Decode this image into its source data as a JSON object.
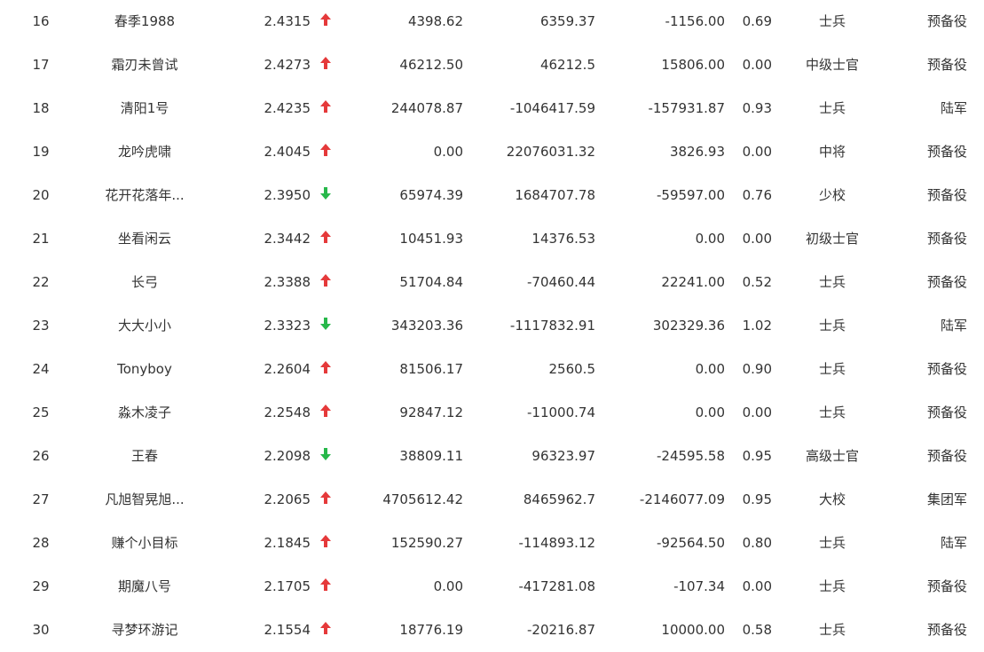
{
  "colors": {
    "up": "#e5393a",
    "down": "#27b84a",
    "text": "#333333"
  },
  "rows": [
    {
      "rank": "16",
      "name": "春季1988",
      "score": "2.4315",
      "trend": "up",
      "v1": "4398.62",
      "v2": "6359.37",
      "v3": "-1156.00",
      "ratio": "0.69",
      "rank_title": "士兵",
      "unit": "预备役"
    },
    {
      "rank": "17",
      "name": "霜刃未曾试",
      "score": "2.4273",
      "trend": "up",
      "v1": "46212.50",
      "v2": "46212.5",
      "v3": "15806.00",
      "ratio": "0.00",
      "rank_title": "中级士官",
      "unit": "预备役"
    },
    {
      "rank": "18",
      "name": "清阳1号",
      "score": "2.4235",
      "trend": "up",
      "v1": "244078.87",
      "v2": "-1046417.59",
      "v3": "-157931.87",
      "ratio": "0.93",
      "rank_title": "士兵",
      "unit": "陆军"
    },
    {
      "rank": "19",
      "name": "龙吟虎啸",
      "score": "2.4045",
      "trend": "up",
      "v1": "0.00",
      "v2": "22076031.32",
      "v3": "3826.93",
      "ratio": "0.00",
      "rank_title": "中将",
      "unit": "预备役"
    },
    {
      "rank": "20",
      "name": "花开花落年...",
      "score": "2.3950",
      "trend": "down",
      "v1": "65974.39",
      "v2": "1684707.78",
      "v3": "-59597.00",
      "ratio": "0.76",
      "rank_title": "少校",
      "unit": "预备役"
    },
    {
      "rank": "21",
      "name": "坐看闲云",
      "score": "2.3442",
      "trend": "up",
      "v1": "10451.93",
      "v2": "14376.53",
      "v3": "0.00",
      "ratio": "0.00",
      "rank_title": "初级士官",
      "unit": "预备役"
    },
    {
      "rank": "22",
      "name": "长弓",
      "score": "2.3388",
      "trend": "up",
      "v1": "51704.84",
      "v2": "-70460.44",
      "v3": "22241.00",
      "ratio": "0.52",
      "rank_title": "士兵",
      "unit": "预备役"
    },
    {
      "rank": "23",
      "name": "大大小小",
      "score": "2.3323",
      "trend": "down",
      "v1": "343203.36",
      "v2": "-1117832.91",
      "v3": "302329.36",
      "ratio": "1.02",
      "rank_title": "士兵",
      "unit": "陆军"
    },
    {
      "rank": "24",
      "name": "Tonyboy",
      "score": "2.2604",
      "trend": "up",
      "v1": "81506.17",
      "v2": "2560.5",
      "v3": "0.00",
      "ratio": "0.90",
      "rank_title": "士兵",
      "unit": "预备役"
    },
    {
      "rank": "25",
      "name": "淼木凌子",
      "score": "2.2548",
      "trend": "up",
      "v1": "92847.12",
      "v2": "-11000.74",
      "v3": "0.00",
      "ratio": "0.00",
      "rank_title": "士兵",
      "unit": "预备役"
    },
    {
      "rank": "26",
      "name": "王春",
      "score": "2.2098",
      "trend": "down",
      "v1": "38809.11",
      "v2": "96323.97",
      "v3": "-24595.58",
      "ratio": "0.95",
      "rank_title": "高级士官",
      "unit": "预备役"
    },
    {
      "rank": "27",
      "name": "凡旭智晃旭...",
      "score": "2.2065",
      "trend": "up",
      "v1": "4705612.42",
      "v2": "8465962.7",
      "v3": "-2146077.09",
      "ratio": "0.95",
      "rank_title": "大校",
      "unit": "集团军"
    },
    {
      "rank": "28",
      "name": "赚个小目标",
      "score": "2.1845",
      "trend": "up",
      "v1": "152590.27",
      "v2": "-114893.12",
      "v3": "-92564.50",
      "ratio": "0.80",
      "rank_title": "士兵",
      "unit": "陆军"
    },
    {
      "rank": "29",
      "name": "期魔八号",
      "score": "2.1705",
      "trend": "up",
      "v1": "0.00",
      "v2": "-417281.08",
      "v3": "-107.34",
      "ratio": "0.00",
      "rank_title": "士兵",
      "unit": "预备役"
    },
    {
      "rank": "30",
      "name": "寻梦环游记",
      "score": "2.1554",
      "trend": "up",
      "v1": "18776.19",
      "v2": "-20216.87",
      "v3": "10000.00",
      "ratio": "0.58",
      "rank_title": "士兵",
      "unit": "预备役"
    }
  ]
}
